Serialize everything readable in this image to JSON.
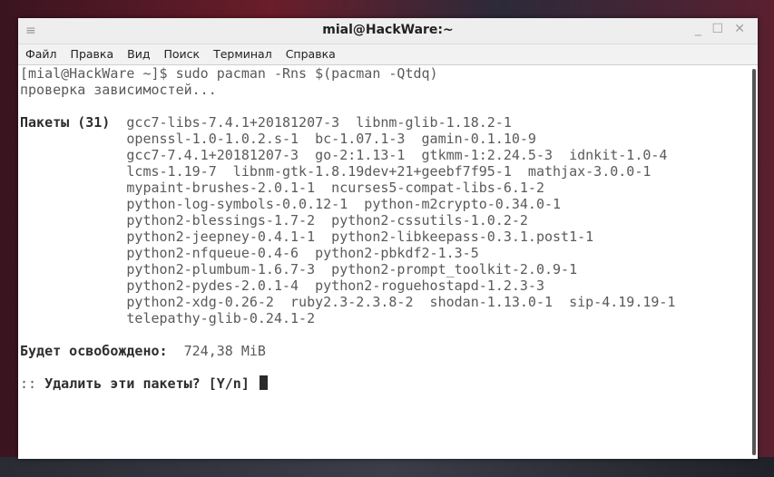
{
  "window": {
    "title": "mial@HackWare:~",
    "controls": {
      "menu_icon": "≡",
      "minimize": "_",
      "maximize": "☐",
      "close": "✕"
    }
  },
  "menu": [
    "Файл",
    "Правка",
    "Вид",
    "Поиск",
    "Терминал",
    "Справка"
  ],
  "terminal": {
    "prompt": "[mial@HackWare ~]$ sudo pacman -Rns $(pacman -Qtdq)",
    "checking": "проверка зависимостей...",
    "packages_label": "Пакеты (31)",
    "package_lines": [
      "gcc7-libs-7.4.1+20181207-3  libnm-glib-1.18.2-1",
      "openssl-1.0-1.0.2.s-1  bc-1.07.1-3  gamin-0.1.10-9",
      "gcc7-7.4.1+20181207-3  go-2:1.13-1  gtkmm-1:2.24.5-3  idnkit-1.0-4",
      "lcms-1.19-7  libnm-gtk-1.8.19dev+21+geebf7f95-1  mathjax-3.0.0-1",
      "mypaint-brushes-2.0.1-1  ncurses5-compat-libs-6.1-2",
      "python-log-symbols-0.0.12-1  python-m2crypto-0.34.0-1",
      "python2-blessings-1.7-2  python2-cssutils-1.0.2-2",
      "python2-jeepney-0.4.1-1  python2-libkeepass-0.3.1.post1-1",
      "python2-nfqueue-0.4-6  python2-pbkdf2-1.3-5",
      "python2-plumbum-1.6.7-3  python2-prompt_toolkit-2.0.9-1",
      "python2-pydes-2.0.1-4  python2-roguehostapd-1.2.3-3",
      "python2-xdg-0.26-2  ruby2.3-2.3.8-2  shodan-1.13.0-1  sip-4.19.19-1",
      "telepathy-glib-0.24.1-2"
    ],
    "freed_label": "Будет освобождено:",
    "freed_value": "724,38 MiB",
    "question_prefix": "::",
    "question": "Удалить эти пакеты? [Y/n]"
  },
  "colors": {
    "terminal_bg": "#ffffff",
    "terminal_fg": "#5a5a5a",
    "bold_fg": "#2e2e2e"
  }
}
